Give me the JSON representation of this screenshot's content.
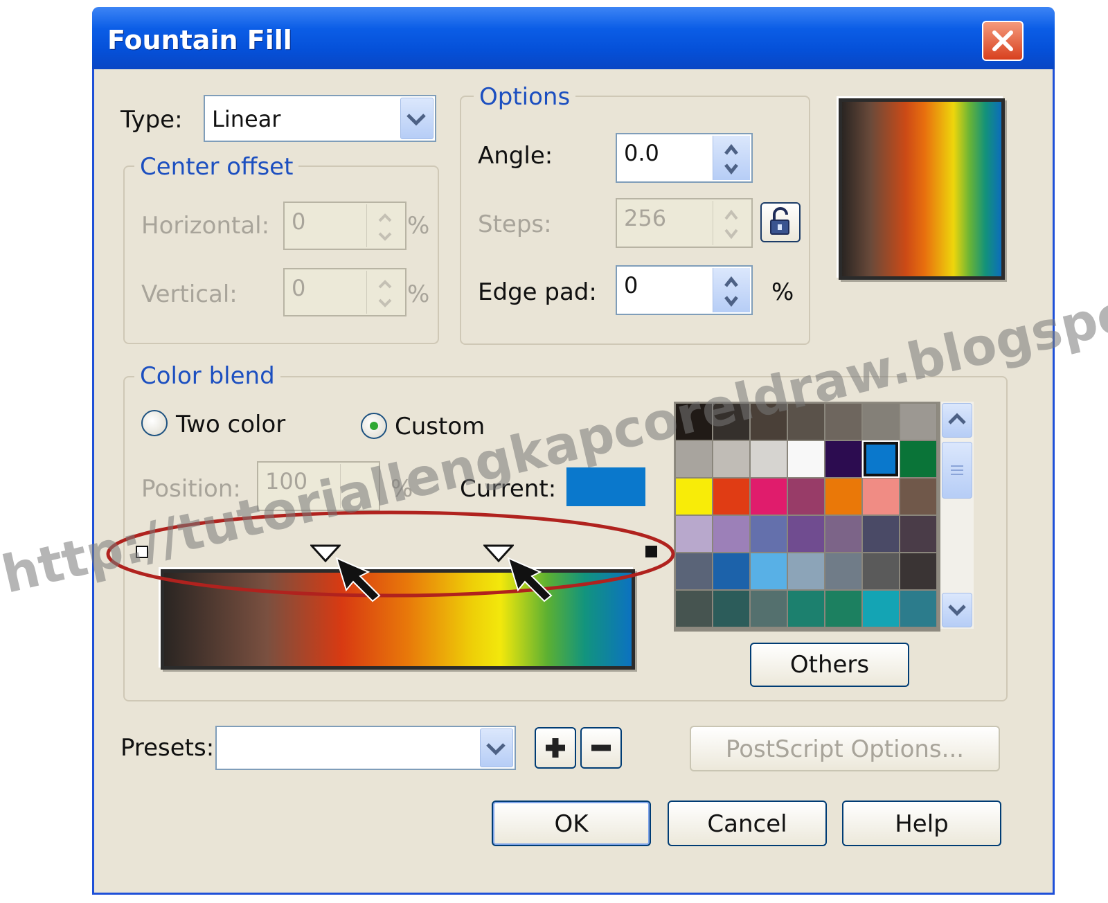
{
  "window": {
    "title": "Fountain Fill"
  },
  "type": {
    "label": "Type:",
    "value": "Linear"
  },
  "center_offset": {
    "title": "Center offset",
    "horizontal_label": "Horizontal:",
    "horizontal_value": "0",
    "vertical_label": "Vertical:",
    "vertical_value": "0",
    "unit": "%"
  },
  "options": {
    "title": "Options",
    "angle_label": "Angle:",
    "angle_value": "0.0",
    "steps_label": "Steps:",
    "steps_value": "256",
    "edge_pad_label": "Edge pad:",
    "edge_pad_value": "0",
    "unit": "%"
  },
  "color_blend": {
    "title": "Color blend",
    "two_color_label": "Two color",
    "custom_label": "Custom",
    "selected_mode": "Custom",
    "position_label": "Position:",
    "position_value": "100",
    "position_unit": "%",
    "current_label": "Current:",
    "current_color": "#0a78cc",
    "others_label": "Others"
  },
  "palette": {
    "swatches": [
      "#201a16",
      "#35302c",
      "#4a4038",
      "#5a524a",
      "#6e665e",
      "#848078",
      "#9c9892",
      "#a8a49e",
      "#c0bcb6",
      "#d6d4d0",
      "#f8f8f8",
      "#2c0c50",
      "#0a78cc",
      "#0a7438",
      "#f8ec08",
      "#e03c14",
      "#e01c6c",
      "#983c68",
      "#ea7808",
      "#f08c84",
      "#70584a",
      "#b8a8cc",
      "#9c80b8",
      "#6470ac",
      "#704c90",
      "#7c6488",
      "#4a4a66",
      "#4a3c48",
      "#5a6478",
      "#1c62aa",
      "#58b0e6",
      "#8ca4b8",
      "#707c88",
      "#5a5a5a",
      "#3a3434",
      "#465450",
      "#2c5c5a",
      "#54706e",
      "#1c806e",
      "#1c8060",
      "#14a4b4",
      "#2c7c8c"
    ],
    "selected_index": 12
  },
  "presets": {
    "label": "Presets:",
    "value": "",
    "add_icon": "plus-icon",
    "remove_icon": "minus-icon"
  },
  "buttons": {
    "postscript": "PostScript Options...",
    "ok": "OK",
    "cancel": "Cancel",
    "help": "Help"
  },
  "watermark": "http://tutoriallengkapcoreldraw.blogspot.com/"
}
